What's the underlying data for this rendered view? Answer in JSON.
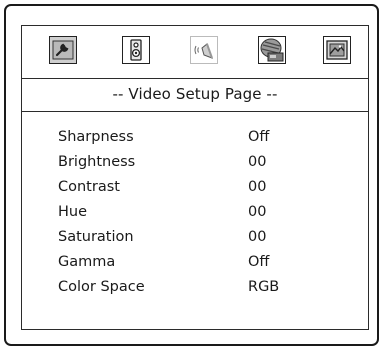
{
  "tabs": [
    {
      "icon": "wrench-icon"
    },
    {
      "icon": "speaker-icon"
    },
    {
      "icon": "audio-waves-icon"
    },
    {
      "icon": "disc-icon"
    },
    {
      "icon": "picture-icon"
    }
  ],
  "page": {
    "title": "-- Video Setup Page --"
  },
  "settings": [
    {
      "label": "Sharpness",
      "value": "Off"
    },
    {
      "label": "Brightness",
      "value": "00"
    },
    {
      "label": "Contrast",
      "value": "00"
    },
    {
      "label": "Hue",
      "value": "00"
    },
    {
      "label": "Saturation",
      "value": "00"
    },
    {
      "label": "Gamma",
      "value": "Off"
    },
    {
      "label": "Color Space",
      "value": "RGB"
    }
  ]
}
